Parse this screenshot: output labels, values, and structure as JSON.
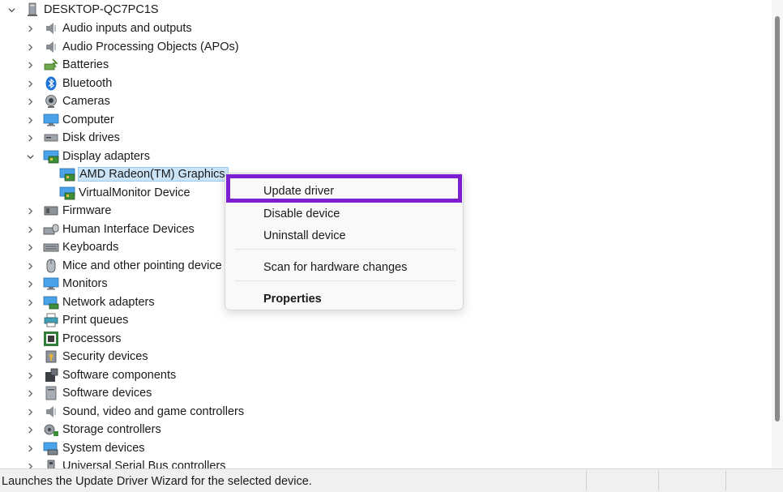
{
  "tree": {
    "root": {
      "label": "DESKTOP-QC7PC1S",
      "icon": "computer-icon",
      "expanded": true
    },
    "categories": [
      {
        "label": "Audio inputs and outputs",
        "icon": "speaker-icon"
      },
      {
        "label": "Audio Processing Objects (APOs)",
        "icon": "speaker-icon"
      },
      {
        "label": "Batteries",
        "icon": "battery-icon"
      },
      {
        "label": "Bluetooth",
        "icon": "bluetooth-icon"
      },
      {
        "label": "Cameras",
        "icon": "camera-icon"
      },
      {
        "label": "Computer",
        "icon": "monitor-icon"
      },
      {
        "label": "Disk drives",
        "icon": "disk-drive-icon"
      },
      {
        "label": "Display adapters",
        "icon": "display-adapter-icon",
        "expanded": true
      },
      {
        "label": "Firmware",
        "icon": "firmware-icon"
      },
      {
        "label": "Human Interface Devices",
        "icon": "hid-icon"
      },
      {
        "label": "Keyboards",
        "icon": "keyboard-icon"
      },
      {
        "label": "Mice and other pointing device",
        "icon": "mouse-icon"
      },
      {
        "label": "Monitors",
        "icon": "monitor-icon"
      },
      {
        "label": "Network adapters",
        "icon": "network-icon"
      },
      {
        "label": "Print queues",
        "icon": "printer-icon"
      },
      {
        "label": "Processors",
        "icon": "processor-icon"
      },
      {
        "label": "Security devices",
        "icon": "security-icon"
      },
      {
        "label": "Software components",
        "icon": "software-component-icon"
      },
      {
        "label": "Software devices",
        "icon": "software-device-icon"
      },
      {
        "label": "Sound, video and game controllers",
        "icon": "speaker-icon"
      },
      {
        "label": "Storage controllers",
        "icon": "storage-icon"
      },
      {
        "label": "System devices",
        "icon": "system-icon"
      },
      {
        "label": "Universal Serial Bus controllers",
        "icon": "usb-icon"
      }
    ],
    "display_adapter_children": [
      {
        "label": "AMD Radeon(TM) Graphics",
        "icon": "display-adapter-icon",
        "selected": true
      },
      {
        "label": "VirtualMonitor Device",
        "icon": "display-adapter-icon"
      }
    ]
  },
  "context_menu": {
    "items": [
      {
        "label": "Update driver",
        "highlighted": true
      },
      {
        "label": "Disable device"
      },
      {
        "label": "Uninstall device"
      },
      {
        "label": "Scan for hardware changes"
      },
      {
        "label": "Properties",
        "bold": true
      }
    ],
    "highlight_color": "#7b1fd1"
  },
  "status_bar": {
    "text": "Launches the Update Driver Wizard for the selected device."
  },
  "colors": {
    "selection_bg": "#cce4f7",
    "accent_blue": "#0078d4"
  }
}
